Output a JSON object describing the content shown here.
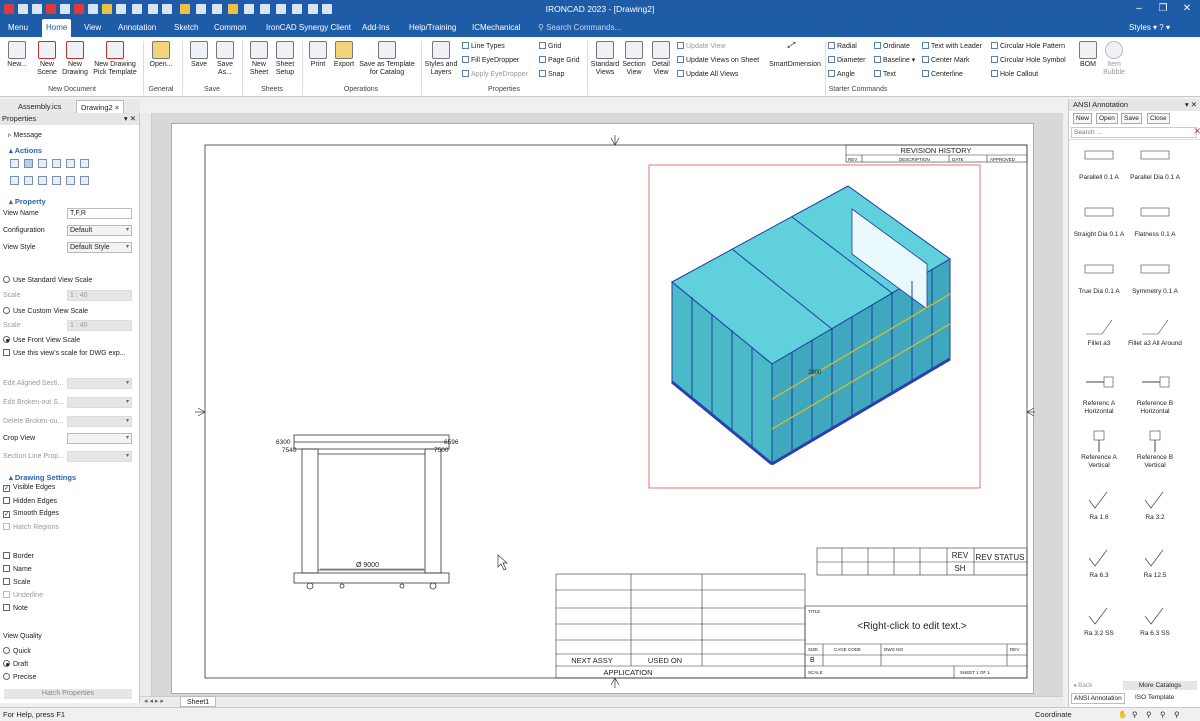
{
  "window": {
    "title": "IRONCAD 2023 - [Drawing2]"
  },
  "menubar": {
    "tabs": [
      "Menu",
      "Home",
      "View",
      "Annotation",
      "Sketch",
      "Common",
      "IronCAD Synergy Client",
      "Add-Ins",
      "Help/Training",
      "ICMechanical"
    ],
    "search_placeholder": "Search Commands...",
    "styles_label": "Styles",
    "help_label": "?"
  },
  "ribbon": {
    "new_document": {
      "group": "New Document",
      "buttons": [
        "New...",
        "New Scene",
        "New Drawing",
        "New Drawing Pick Template"
      ]
    },
    "general": {
      "group": "General",
      "buttons": [
        "Open..."
      ]
    },
    "save": {
      "group": "Save",
      "buttons": [
        "Save",
        "Save As..."
      ]
    },
    "sheets": {
      "group": "Sheets",
      "buttons": [
        "New Sheet",
        "Sheet Setup"
      ]
    },
    "operations": {
      "group": "Operations",
      "buttons": [
        "Print",
        "Export",
        "Save as Template for Catalog"
      ]
    },
    "properties": {
      "group": "Properties",
      "styles_layers": "Styles and Layers",
      "line_types": "Line Types",
      "fill_eyedropper": "Fill EyeDropper",
      "apply_eyedropper": "Apply EyeDropper",
      "grid": "Grid",
      "page_grid": "Page Grid",
      "snap": "Snap"
    },
    "views": {
      "standard": "Standard Views",
      "section": "Section View",
      "detail": "Detail View",
      "update_view": "Update View",
      "update_views_on_sheet": "Update Views on Sheet",
      "update_all_views": "Update All Views",
      "smart_dimension": "SmartDimension"
    },
    "starter": {
      "group": "Starter Commands",
      "radial": "Radial",
      "diameter": "Diameter",
      "angle": "Angle",
      "ordinate": "Ordinate",
      "baseline": "Baseline",
      "text": "Text",
      "text_with_leader": "Text with Leader",
      "center_mark": "Center Mark",
      "centerline": "Centerline",
      "circular_hole_pattern": "Circular Hole Pattern",
      "circular_hole_symbol": "Circular Hole Symbol",
      "hole_callout": "Hole Callout",
      "bom": "BOM",
      "item_bubble": "Item Bubble"
    }
  },
  "doc_tabs": [
    "Assembly.ics",
    "Drawing2"
  ],
  "props": {
    "title": "Properties",
    "message": "Message",
    "actions": "Actions",
    "property": "Property",
    "view_name_label": "View Name",
    "view_name_value": "T,F,R",
    "configuration_label": "Configuration",
    "configuration_value": "Default",
    "view_style_label": "View Style",
    "view_style_value": "Default Style",
    "use_standard_scale": "Use Standard View Scale",
    "scale_label": "Scale",
    "scale_value_1": "1 : 40",
    "use_custom_scale": "Use Custom View Scale",
    "scale_value_2": "1 : 40",
    "use_front_scale": "Use Front View Scale",
    "use_dwg_scale": "Use this view's scale for DWG exp...",
    "edit_aligned": "Edit Aligned Secti...",
    "edit_broken": "Edit Broken-out S...",
    "delete_broken": "Delete Broken-ou...",
    "crop_view": "Crop View",
    "section_line": "Section Line Prop...",
    "drawing_settings": "Drawing Settings",
    "visible_edges": "Visible Edges",
    "hidden_edges": "Hidden Edges",
    "smooth_edges": "Smooth Edges",
    "hatch_regions": "Hatch Regions",
    "border": "Border",
    "name": "Name",
    "scale": "Scale",
    "underline": "Underline",
    "note": "Note",
    "view_quality": "View Quality",
    "quick": "Quick",
    "draft": "Draft",
    "precise": "Precise",
    "hatch_props": "Hatch Properties"
  },
  "drawing": {
    "revision_history": "REVISION HISTORY",
    "rev_cols": [
      "REV",
      "DESCRIPTION",
      "DATE",
      "APPROVED"
    ],
    "rev": "REV",
    "sh": "SH",
    "rev_status": "REV STATUS",
    "title_label": "TITLE",
    "edit_text": "<Right-click to edit text.>",
    "size_label": "SIZE",
    "size_value": "B",
    "cage_code": "CAGE CODE",
    "dwg_no": "DWG NO",
    "rev_small": "REV",
    "scale_label": "SCALE",
    "sheet_label": "SHEET 1 OF 1",
    "next_assy": "NEXT ASSY",
    "used_on": "USED ON",
    "application": "APPLICATION",
    "dim_left": "6300",
    "dim_left2": "7540",
    "dim_right": "6596",
    "dim_right2": "7500",
    "dim_bottom": "Ø 9000",
    "iso_dim": "2800"
  },
  "sheet_tab": "Sheet1",
  "annotation": {
    "title": "ANSI Annotation",
    "buttons": [
      "New",
      "Open",
      "Save",
      "Close"
    ],
    "search": "Search ...",
    "items": [
      "Parallell 0.1 A",
      "Parallel Dia 0.1 A",
      "Straight Dia 0.1 A",
      "Flatness 0.1 A",
      "True Dia 0.1 A",
      "Symmetry 0.1 A",
      "Fillet a3",
      "Fillet a3 All Around",
      "Referenc A Horizontal",
      "Reference B Horizontal",
      "Reference A Vertical",
      "Reference B Vertical",
      "Ra 1.6",
      "Ra 3.2",
      "Ra 6.3",
      "Ra 12.5",
      "Ra 3.2 SS",
      "Ra 6.3 SS"
    ],
    "back": "Back",
    "more": "More Catalogs",
    "tab1": "ANSI Annotation",
    "tab2": "ISO Template"
  },
  "status": {
    "help": "For Help, press F1",
    "coordinate": "Coordinate"
  },
  "colors": {
    "brand": "#1e5ca8",
    "model_cyan": "#5fd0dc",
    "model_blue": "#2a3fb0",
    "crop_red": "#e05050"
  }
}
